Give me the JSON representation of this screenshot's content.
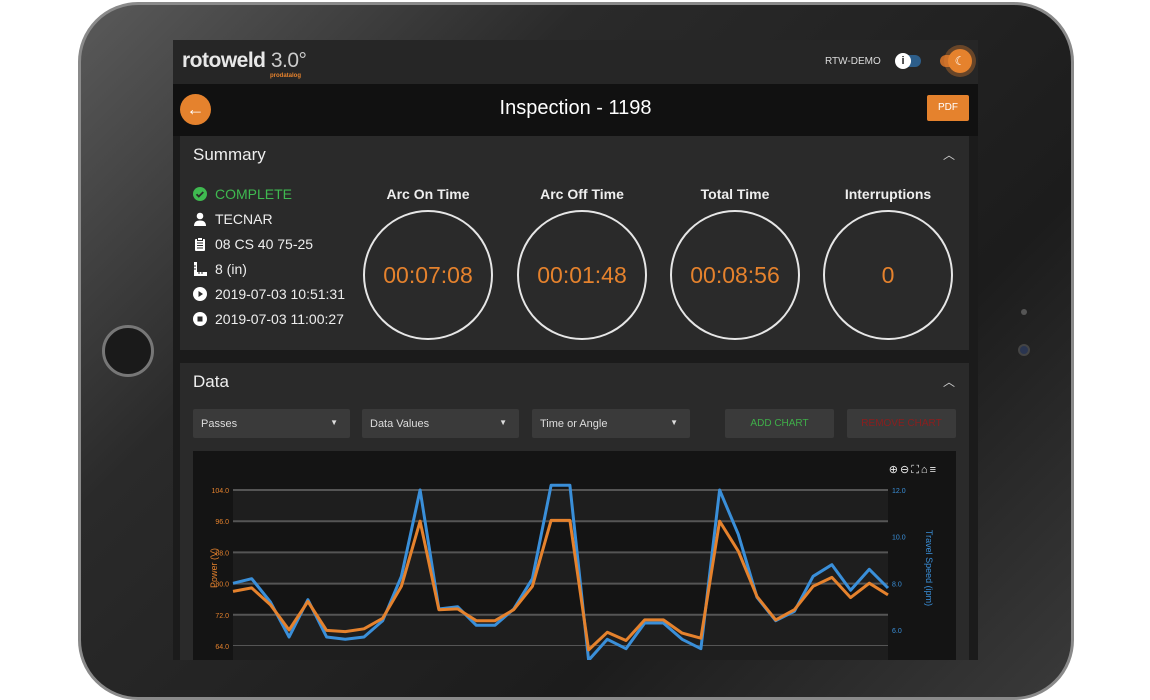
{
  "header": {
    "logo": "rotoweld",
    "version": "3.0°",
    "logo_sub": "prodatalog",
    "user": "RTW-DEMO",
    "info_icon": "info-toggle-icon",
    "theme_icon": "moon-icon"
  },
  "titlebar": {
    "title": "Inspection - 1198",
    "pdf_label": "PDF",
    "back_icon": "arrow-left-icon"
  },
  "summary": {
    "title": "Summary",
    "status": "COMPLETE",
    "operator": "TECNAR",
    "procedure": "08 CS 40 75-25",
    "diameter": "8 (in)",
    "start": "2019-07-03 10:51:31",
    "end": "2019-07-03 11:00:27",
    "metrics": [
      {
        "label": "Arc On Time",
        "value": "00:07:08"
      },
      {
        "label": "Arc Off Time",
        "value": "00:01:48"
      },
      {
        "label": "Total Time",
        "value": "00:08:56"
      },
      {
        "label": "Interruptions",
        "value": "0"
      }
    ]
  },
  "data_section": {
    "title": "Data",
    "dropdowns": [
      "Passes",
      "Data Values",
      "Time or Angle"
    ],
    "add_chart": "ADD CHART",
    "remove_chart": "REMOVE CHART"
  },
  "colors": {
    "accent": "#e5822d",
    "complete": "#3fb950",
    "add": "#3fae49",
    "remove": "#8b1e1e",
    "series_power": "#e5822d",
    "series_speed": "#3a8fd9"
  },
  "chart_data": {
    "type": "line",
    "ylabel_left": "Power (V)",
    "ylabel_right": "Travel Speed (ipm)",
    "left_ticks": [
      "104.0",
      "96.0",
      "88.0",
      "80.0",
      "72.0",
      "64.0"
    ],
    "right_ticks": [
      "12.0",
      "10.0",
      "8.0",
      "6.0"
    ],
    "ylim_left": [
      64,
      104
    ],
    "ylim_right": [
      6,
      12
    ],
    "grid": true,
    "series": [
      {
        "axis": "left",
        "color": "#e5822d",
        "values": [
          78,
          78.9,
          74.6,
          68.1,
          75.4,
          68,
          67.7,
          68.4,
          71.1,
          79.3,
          96,
          73.3,
          73.5,
          70.5,
          70.5,
          73.3,
          79.3,
          96.2,
          96.2,
          63,
          67.5,
          65.4,
          70.7,
          70.7,
          67.3,
          66,
          96,
          88.3,
          76.7,
          70.7,
          73.3,
          79.3,
          81.6,
          76.4,
          80.1,
          77.1
        ]
      },
      {
        "axis": "right",
        "color": "#3a8fd9",
        "values": [
          8.0,
          8.2,
          7.2,
          5.7,
          7.3,
          5.7,
          5.6,
          5.7,
          6.4,
          8.3,
          12.0,
          6.9,
          7.0,
          6.2,
          6.2,
          6.9,
          8.2,
          12.2,
          12.2,
          4.7,
          5.6,
          5.2,
          6.3,
          6.3,
          5.6,
          5.2,
          12.0,
          10.1,
          7.4,
          6.4,
          6.8,
          8.3,
          8.8,
          7.7,
          8.6,
          7.8
        ]
      }
    ]
  }
}
